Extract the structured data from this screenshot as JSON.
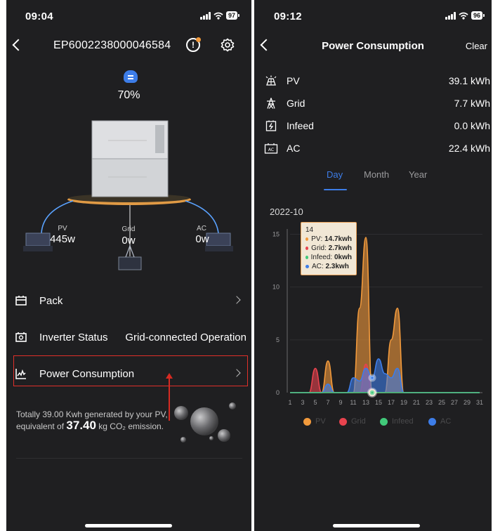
{
  "left": {
    "status_time": "09:04",
    "battery_level": "97",
    "device_id": "EP6002238000046584",
    "alert_icon_glyph": "!",
    "soc": "70%",
    "nodes": {
      "pv": {
        "label": "PV",
        "value": "445w"
      },
      "grid": {
        "label": "Grid",
        "value": "0w"
      },
      "ac": {
        "label": "AC",
        "value": "0w"
      }
    },
    "menu": {
      "pack": "Pack",
      "inverter_status": "Inverter Status",
      "inverter_status_value": "Grid-connected Operation",
      "power_consumption": "Power Consumption"
    },
    "summary": {
      "prefix": "Totally 39.00 Kwh generated by your PV, equivalent of",
      "co2": "37.40",
      "unit": "kg CO₂",
      "suffix": "emission."
    }
  },
  "right": {
    "status_time": "09:12",
    "battery_level": "96",
    "title": "Power Consumption",
    "clear": "Clear",
    "stats": [
      {
        "icon": "solar-panel-icon",
        "label": "PV",
        "value": "39.1 kWh"
      },
      {
        "icon": "grid-tower-icon",
        "label": "Grid",
        "value": "7.7 kWh"
      },
      {
        "icon": "infeed-icon",
        "label": "Infeed",
        "value": "0.0 kWh"
      },
      {
        "icon": "ac-outlet-icon",
        "label": "AC",
        "value": "22.4 kWh"
      }
    ],
    "tabs": {
      "day": "Day",
      "month": "Month",
      "year": "Year",
      "active": "Day"
    },
    "month_label": "2022-10",
    "tooltip": {
      "title": "14",
      "rows": [
        {
          "name": "PV",
          "value": "14.7kwh",
          "color": "#f29a3c"
        },
        {
          "name": "Grid",
          "value": "2.7kwh",
          "color": "#e8434e"
        },
        {
          "name": "Infeed",
          "value": "0kwh",
          "color": "#41c97a"
        },
        {
          "name": "AC",
          "value": "2.3kwh",
          "color": "#3d7de8"
        }
      ]
    },
    "legend": [
      {
        "name": "PV",
        "color": "#f29a3c"
      },
      {
        "name": "Grid",
        "color": "#e8434e"
      },
      {
        "name": "Infeed",
        "color": "#41c97a"
      },
      {
        "name": "AC",
        "color": "#3d7de8"
      }
    ]
  },
  "chart_data": {
    "type": "area",
    "x": [
      1,
      2,
      3,
      4,
      5,
      6,
      7,
      8,
      9,
      10,
      11,
      12,
      13,
      14,
      15,
      16,
      17,
      18,
      19,
      20,
      21,
      22,
      23,
      24,
      25,
      26,
      27,
      28,
      29,
      30,
      31
    ],
    "xticks": [
      1,
      3,
      5,
      7,
      9,
      11,
      13,
      15,
      17,
      19,
      21,
      23,
      25,
      27,
      29,
      31
    ],
    "yticks": [
      0,
      5,
      10,
      15
    ],
    "ylim": [
      0,
      15.5
    ],
    "series": [
      {
        "name": "PV",
        "color": "#f29a3c",
        "values": [
          0,
          0,
          0,
          0,
          0,
          0,
          3,
          0,
          0,
          0,
          0,
          8,
          14.7,
          0,
          0,
          0,
          5,
          8,
          0,
          0,
          0,
          0,
          0,
          0,
          0,
          0,
          0,
          0,
          0,
          0,
          0
        ]
      },
      {
        "name": "Grid",
        "color": "#e8434e",
        "values": [
          0,
          0,
          0,
          0,
          2.3,
          0,
          0,
          0,
          0,
          0,
          0,
          0,
          2.7,
          0,
          0,
          0,
          0,
          0,
          0,
          0,
          0,
          0,
          0,
          0,
          0,
          0,
          0,
          0,
          0,
          0,
          0
        ]
      },
      {
        "name": "Infeed",
        "color": "#41c97a",
        "values": [
          0,
          0,
          0,
          0,
          0,
          0,
          0,
          0,
          0,
          0,
          0,
          0,
          0,
          0,
          0,
          0,
          0,
          0,
          0,
          0,
          0,
          0,
          0,
          0,
          0,
          0,
          0,
          0,
          0,
          0,
          0
        ]
      },
      {
        "name": "AC",
        "color": "#3d7de8",
        "values": [
          0,
          0,
          0,
          0,
          0,
          0,
          0.8,
          0,
          0,
          0,
          1.4,
          1.1,
          2.3,
          1.4,
          3.2,
          1.8,
          1.4,
          2.3,
          0,
          0,
          0,
          0,
          0,
          0,
          0,
          0,
          0,
          0,
          0,
          0,
          0
        ]
      }
    ],
    "highlight_x": 14,
    "legend_position": "bottom"
  }
}
